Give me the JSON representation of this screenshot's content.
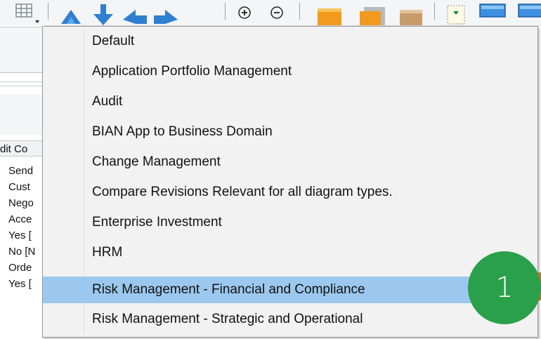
{
  "toolbar": {
    "buttons": [
      {
        "icon": "grid-view-icon"
      },
      {
        "icon": "arrow-up-icon"
      },
      {
        "icon": "arrow-down-icon"
      },
      {
        "icon": "arrow-left-icon"
      },
      {
        "icon": "arrow-right-icon"
      },
      {
        "icon": "zoom-in-icon"
      },
      {
        "icon": "zoom-out-icon"
      },
      {
        "icon": "orange-block-icon"
      },
      {
        "icon": "orange-layers-icon"
      },
      {
        "icon": "tan-block-icon"
      },
      {
        "icon": "dropdown-box-icon"
      },
      {
        "icon": "blue-rect-icon"
      },
      {
        "icon": "blue-rect-icon-2"
      }
    ]
  },
  "left_panel": {
    "header": "dit Co",
    "rows": [
      "Send",
      "Cust",
      "Nego",
      "Acce",
      "Yes [",
      "No [N",
      "Orde",
      "Yes ["
    ]
  },
  "menu": {
    "items": [
      "Default",
      "Application Portfolio Management",
      "Audit",
      "BIAN App to Business Domain",
      "Change Management",
      "Compare Revisions Relevant for all diagram types.",
      "Enterprise Investment",
      "HRM",
      "Risk Management - Financial and Compliance",
      "Risk Management - Strategic and Operational"
    ],
    "selected_index": 8
  },
  "badge": {
    "label": "1",
    "color": "#2aa04a"
  },
  "colors": {
    "selection": "#9cc8ef",
    "menu_bg": "#f2f2f2"
  }
}
